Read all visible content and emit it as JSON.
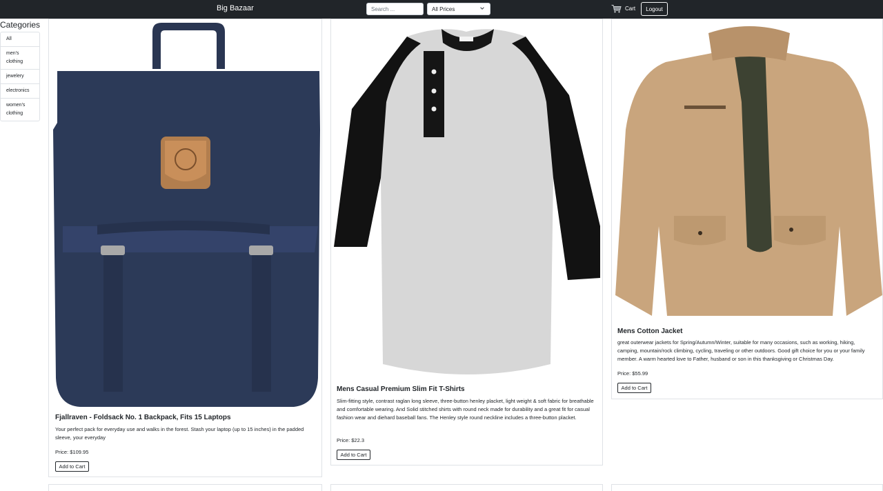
{
  "navbar": {
    "brand": "Big Bazaar",
    "search_placeholder": "Search ...",
    "price_filter": "All Prices",
    "cart_label": "Cart",
    "logout_label": "Logout"
  },
  "sidebar": {
    "title": "Categories",
    "items": [
      {
        "label": "All"
      },
      {
        "label": "men's clothing"
      },
      {
        "label": "jewelery"
      },
      {
        "label": "electronics"
      },
      {
        "label": "women's clothing"
      }
    ]
  },
  "products": [
    {
      "title": "Fjallraven - Foldsack No. 1 Backpack, Fits 15 Laptops",
      "description": "Your perfect pack for everyday use and walks in the forest. Stash your laptop (up to 15 inches) in the padded sleeve, your everyday",
      "price": "Price: $109.95",
      "button": "Add to Cart"
    },
    {
      "title": "Mens Casual Premium Slim Fit T-Shirts",
      "description": "Slim-fitting style, contrast raglan long sleeve, three-button henley placket, light weight & soft fabric for breathable and comfortable wearing. And Solid stitched shirts with round neck made for durability and a great fit for casual fashion wear and diehard baseball fans. The Henley style round neckline includes a three-button placket.",
      "price": "Price: $22.3",
      "button": "Add to Cart"
    },
    {
      "title": "Mens Cotton Jacket",
      "description": "great outerwear jackets for Spring/Autumn/Winter, suitable for many occasions, such as working, hiking, camping, mountain/rock climbing, cycling, traveling or other outdoors. Good gift choice for you or your family member. A warm hearted love to Father, husband or son in this thanksgiving or Christmas Day.",
      "price": "Price: $55.99",
      "button": "Add to Cart"
    }
  ],
  "colors": {
    "navbar_bg": "#212529",
    "backpack": "#2f3d5c",
    "tshirt_body": "#d6d6d6",
    "tshirt_sleeves": "#111111",
    "jacket": "#c9a57d"
  }
}
